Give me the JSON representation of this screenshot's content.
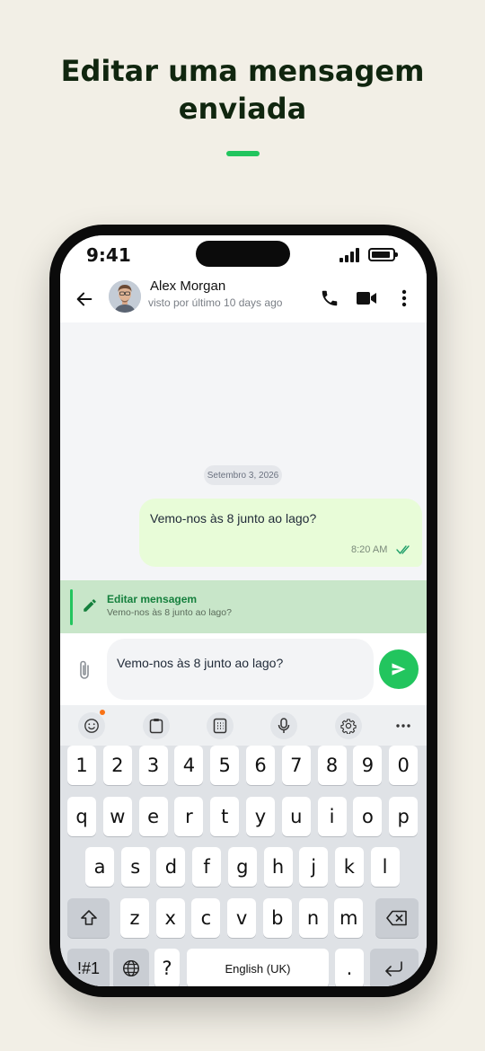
{
  "headline": {
    "line1": "Editar uma mensagem",
    "line2": "enviada"
  },
  "status_bar": {
    "time": "9:41"
  },
  "chat_header": {
    "contact_name": "Alex Morgan",
    "last_seen": "visto por último 10 days ago"
  },
  "messages": {
    "date_chip": "Setembro 3, 2026",
    "items": [
      {
        "text": "Vemo-nos às 8 junto ao lago?",
        "time": "8:20 AM",
        "status": "read"
      }
    ]
  },
  "edit_banner": {
    "title": "Editar mensagem",
    "preview": "Vemo-nos às 8 junto ao lago?"
  },
  "composer": {
    "value": "Vemo-nos às 8 junto ao lago?"
  },
  "keyboard": {
    "toolbar_icons": [
      "emoji-icon",
      "clipboard-icon",
      "keypad-icon",
      "microphone-icon",
      "settings-icon",
      "more-icon"
    ],
    "row_numbers": [
      "1",
      "2",
      "3",
      "4",
      "5",
      "6",
      "7",
      "8",
      "9",
      "0"
    ],
    "row_top": [
      "q",
      "w",
      "e",
      "r",
      "t",
      "y",
      "u",
      "i",
      "o",
      "p"
    ],
    "row_middle": [
      "a",
      "s",
      "d",
      "f",
      "g",
      "h",
      "j",
      "k",
      "l"
    ],
    "row_bottom": [
      "z",
      "x",
      "c",
      "v",
      "b",
      "n",
      "m"
    ],
    "symbols_label": "!#1",
    "question_key": "?",
    "space_label": "English (UK)",
    "period_key": "."
  },
  "colors": {
    "accent": "#22c55e",
    "bubble": "#e8fcd8",
    "edit_banner": "#c8e6c9",
    "headline": "#10260f"
  }
}
